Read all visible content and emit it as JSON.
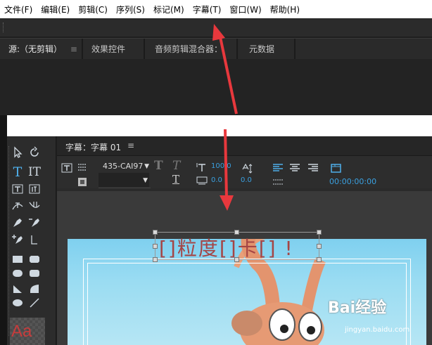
{
  "menubar": {
    "items": [
      "文件(F)",
      "编辑(E)",
      "剪辑(C)",
      "序列(S)",
      "标记(M)",
      "字幕(T)",
      "窗口(W)",
      "帮助(H)"
    ]
  },
  "panel_tabs": {
    "source": "源:（无剪辑）",
    "menu_glyph": "≡",
    "effect_controls": "效果控件",
    "audio_mixer": "音频剪辑混合器：",
    "metadata": "元数据"
  },
  "titler": {
    "title": "字幕：字幕 01",
    "menu_glyph": "≡",
    "font_name": "435-CAI97",
    "tracking_value": "100.0",
    "kerning_value": "0.0",
    "leading_value": "0.0",
    "timecode": "00:00:00:00",
    "title_text": "[]粒度[]卡[] !"
  },
  "tools": {
    "style_swatch": "Aa"
  },
  "watermark": {
    "logo": "Bai经验",
    "url": "jingyan.baidu.com"
  },
  "colors": {
    "annotation_arrow": "#e8383d",
    "accent_blue": "#3aa0e0"
  }
}
